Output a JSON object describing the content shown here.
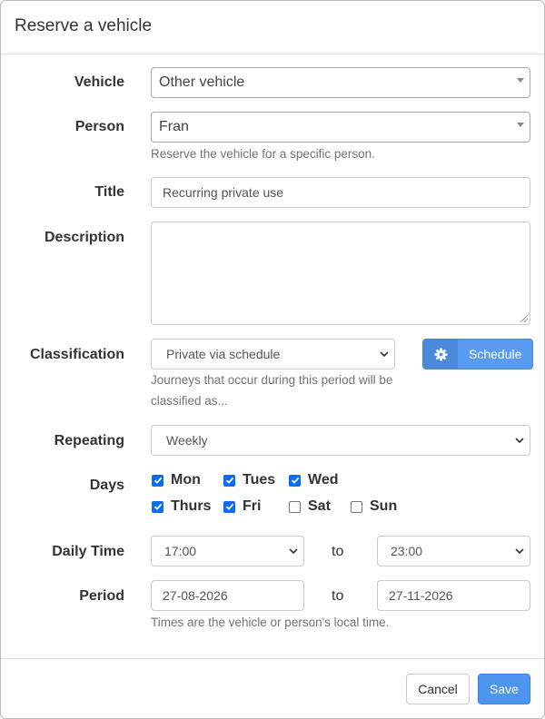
{
  "dialog": {
    "title": "Reserve a vehicle"
  },
  "form": {
    "vehicle": {
      "label": "Vehicle",
      "value": "Other vehicle"
    },
    "person": {
      "label": "Person",
      "value": "Fran",
      "help": "Reserve the vehicle for a specific person."
    },
    "title": {
      "label": "Title",
      "value": "Recurring private use"
    },
    "description": {
      "label": "Description",
      "value": ""
    },
    "classification": {
      "label": "Classification",
      "value": "Private via schedule",
      "help_line1": "Journeys that occur during this period will be",
      "help_line2": "classified as...",
      "schedule_button": "Schedule"
    },
    "repeating": {
      "label": "Repeating",
      "value": "Weekly"
    },
    "days": {
      "label": "Days",
      "items": [
        {
          "name": "Mon",
          "checked": true
        },
        {
          "name": "Tues",
          "checked": true
        },
        {
          "name": "Wed",
          "checked": true
        },
        {
          "name": "Thurs",
          "checked": true
        },
        {
          "name": "Fri",
          "checked": true
        },
        {
          "name": "Sat",
          "checked": false
        },
        {
          "name": "Sun",
          "checked": false
        }
      ]
    },
    "daily_time": {
      "label": "Daily Time",
      "from": "17:00",
      "separator": "to",
      "to": "23:00"
    },
    "period": {
      "label": "Period",
      "from": "27-08-2026",
      "separator": "to",
      "to": "27-11-2026",
      "help": "Times are the vehicle or person's local time."
    }
  },
  "footer": {
    "cancel_label": "Cancel",
    "save_label": "Save"
  },
  "colors": {
    "primary": "#4f94ef",
    "checkbox": "#0b6cf3"
  },
  "icons": {
    "schedule": "gear-icon",
    "select": "chevron-down-icon"
  }
}
